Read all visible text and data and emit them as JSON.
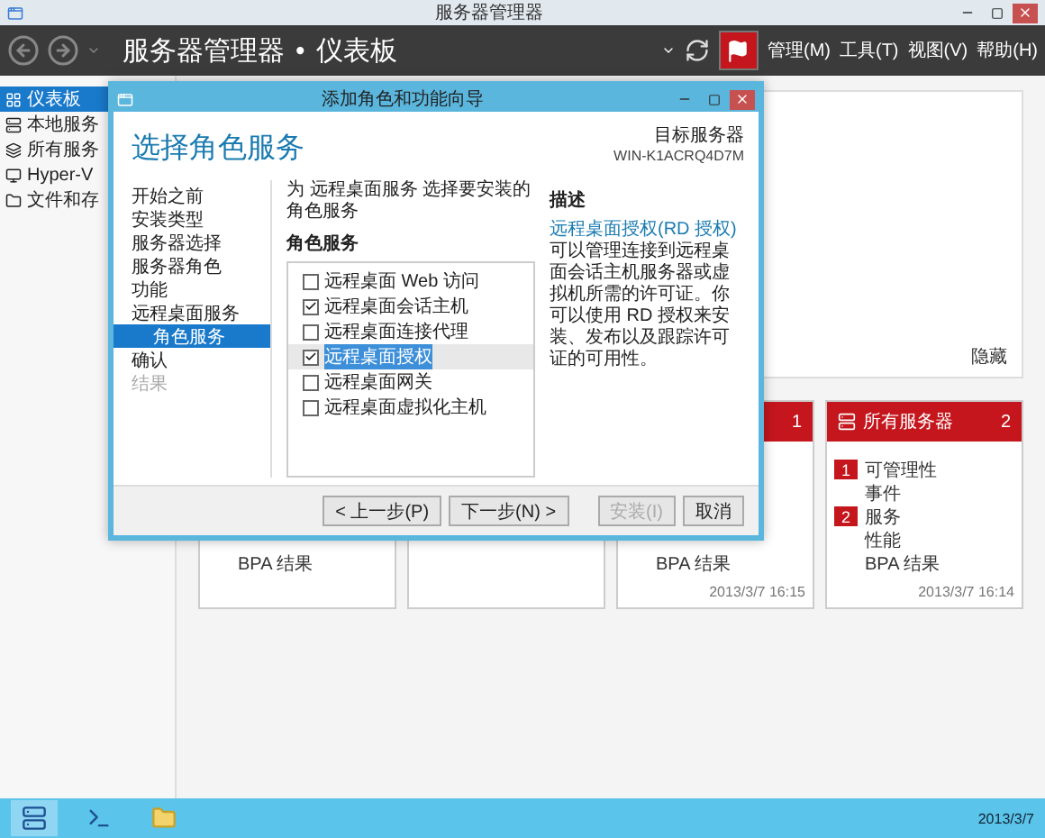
{
  "window": {
    "title": "服务器管理器"
  },
  "header": {
    "breadcrumb": [
      "服务器管理器",
      "仪表板"
    ],
    "separator": "•",
    "notification_alert": true,
    "menus": [
      "管理(M)",
      "工具(T)",
      "视图(V)",
      "帮助(H)"
    ]
  },
  "sidebar": {
    "items": [
      {
        "kind": "dashboard",
        "label": "仪表板",
        "selected": true
      },
      {
        "kind": "server",
        "label": "本地服务",
        "selected": false
      },
      {
        "kind": "servers",
        "label": "所有服务",
        "selected": false
      },
      {
        "kind": "hyperv",
        "label": "Hyper-V",
        "selected": false
      },
      {
        "kind": "storage",
        "label": "文件和存",
        "selected": false
      }
    ]
  },
  "welcome_panel": {
    "hide_link": "隐藏"
  },
  "tiles": [
    {
      "kind": "summary",
      "items": [
        {
          "label": "BPA 结果"
        }
      ]
    },
    {
      "kind": "empty"
    },
    {
      "kind": "summary",
      "alert": true,
      "count": "1",
      "items": [
        {
          "label": "BPA 结果"
        }
      ],
      "timestamp": "2013/3/7 16:15"
    },
    {
      "kind": "summary",
      "alert": true,
      "title": "所有服务器",
      "count": "2",
      "items": [
        {
          "badge": "1",
          "label": "可管理性"
        },
        {
          "label": "事件"
        },
        {
          "badge": "2",
          "label": "服务"
        },
        {
          "label": "性能"
        },
        {
          "label": "BPA 结果"
        }
      ],
      "timestamp": "2013/3/7 16:14"
    }
  ],
  "dialog": {
    "title": "添加角色和功能向导",
    "heading": "选择角色服务",
    "target_label": "目标服务器",
    "target_server": "WIN-K1ACRQ4D7M",
    "steps": [
      {
        "label": "开始之前",
        "selected": false,
        "disabled": false
      },
      {
        "label": "安装类型",
        "selected": false,
        "disabled": false
      },
      {
        "label": "服务器选择",
        "selected": false,
        "disabled": false
      },
      {
        "label": "服务器角色",
        "selected": false,
        "disabled": false
      },
      {
        "label": "功能",
        "selected": false,
        "disabled": false
      },
      {
        "label": "远程桌面服务",
        "selected": false,
        "disabled": false,
        "children": [
          {
            "label": "角色服务",
            "selected": true
          }
        ]
      },
      {
        "label": "确认",
        "selected": false,
        "disabled": false
      },
      {
        "label": "结果",
        "selected": false,
        "disabled": true
      }
    ],
    "instruction": "为 远程桌面服务 选择要安装的角色服务",
    "list_heading": "角色服务",
    "role_services": [
      {
        "label": "远程桌面 Web 访问",
        "checked": false,
        "selected": false
      },
      {
        "label": "远程桌面会话主机",
        "checked": true,
        "selected": false
      },
      {
        "label": "远程桌面连接代理",
        "checked": false,
        "selected": false
      },
      {
        "label": "远程桌面授权",
        "checked": true,
        "selected": true
      },
      {
        "label": "远程桌面网关",
        "checked": false,
        "selected": false
      },
      {
        "label": "远程桌面虚拟化主机",
        "checked": false,
        "selected": false
      }
    ],
    "description_heading": "描述",
    "description": {
      "link": "远程桌面授权(RD 授权)",
      "text": "可以管理连接到远程桌面会话主机服务器或虚拟机所需的许可证。你可以使用 RD 授权来安装、发布以及跟踪许可证的可用性。"
    },
    "buttons": [
      {
        "label": "< 上一步(P)",
        "disabled": false
      },
      {
        "label": "下一步(N) >",
        "disabled": false
      },
      {
        "label": "安装(I)",
        "disabled": true
      },
      {
        "label": "取消",
        "disabled": false
      }
    ]
  },
  "taskbar": {
    "date": "2013/3/7"
  }
}
